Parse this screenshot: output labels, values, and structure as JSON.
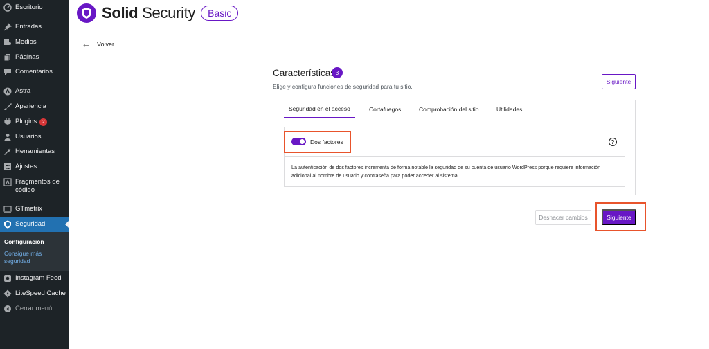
{
  "sidebar": {
    "items": [
      {
        "label": "Escritorio",
        "icon": "dashboard-icon"
      },
      {
        "label": "Entradas",
        "icon": "pin-icon"
      },
      {
        "label": "Medios",
        "icon": "media-icon"
      },
      {
        "label": "Páginas",
        "icon": "pages-icon"
      },
      {
        "label": "Comentarios",
        "icon": "comments-icon"
      },
      {
        "label": "Astra",
        "icon": "astra-icon"
      },
      {
        "label": "Apariencia",
        "icon": "brush-icon"
      },
      {
        "label": "Plugins",
        "icon": "plugin-icon",
        "badge": "2"
      },
      {
        "label": "Usuarios",
        "icon": "users-icon"
      },
      {
        "label": "Herramientas",
        "icon": "wrench-icon"
      },
      {
        "label": "Ajustes",
        "icon": "settings-icon"
      },
      {
        "label": "Fragmentos de código",
        "icon": "code-icon"
      },
      {
        "label": "GTmetrix",
        "icon": "gtmetrix-icon"
      },
      {
        "label": "Seguridad",
        "icon": "shield-icon"
      },
      {
        "label": "Instagram Feed",
        "icon": "instagram-icon"
      },
      {
        "label": "LiteSpeed Cache",
        "icon": "litespeed-icon"
      },
      {
        "label": "Cerrar menú",
        "icon": "collapse-icon"
      }
    ],
    "submenu": {
      "current": "Configuración",
      "link": "Consigue más seguridad"
    }
  },
  "header": {
    "brand_bold": "Solid",
    "brand_rest": " Security",
    "plan": "Basic"
  },
  "back_label": "Volver",
  "main": {
    "title": "Características",
    "count": "3",
    "subtitle": "Elige y configura funciones de seguridad para tu sitio.",
    "top_next_label": "Siguiente",
    "tabs": [
      {
        "label": "Seguridad en el acceso"
      },
      {
        "label": "Cortafuegos"
      },
      {
        "label": "Comprobación del sitio"
      },
      {
        "label": "Utilidades"
      }
    ],
    "feature": {
      "label": "Dos factores",
      "enabled": true,
      "description": "La autenticación de dos factores incrementa de forma notable la seguridad de su cuenta de usuario WordPress porque requiere información adicional al nombre de usuario y contraseña para poder acceder al sistema."
    },
    "undo_label": "Deshacer cambios",
    "next_label": "Siguiente"
  },
  "colors": {
    "accent": "#6817c5",
    "sidebar_bg": "#1d2327",
    "sidebar_active": "#2271b1",
    "highlight": "#e8542c",
    "badge": "#d63638"
  }
}
